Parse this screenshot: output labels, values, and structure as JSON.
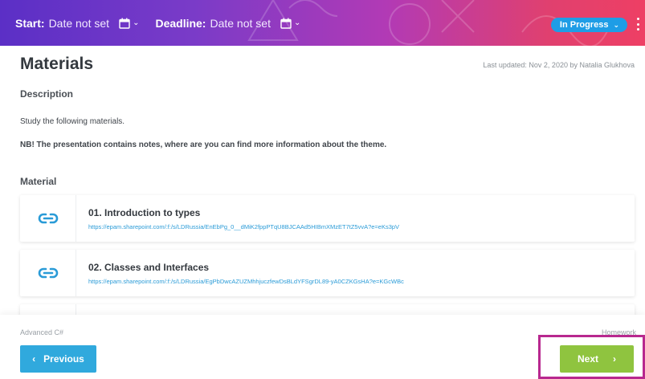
{
  "header": {
    "start_label": "Start:",
    "start_value": "Date not set",
    "deadline_label": "Deadline:",
    "deadline_value": "Date not set",
    "status": "In Progress",
    "calendar_icon": "calendar-icon",
    "chevron_icon": "chevron-down-icon",
    "kebab_icon": "kebab-menu-icon"
  },
  "page": {
    "title": "Materials",
    "updated": "Last updated: Nov 2, 2020 by Natalia Glukhova"
  },
  "description": {
    "heading": "Description",
    "line1": "Study the following materials.",
    "line2": "NB! The presentation contains notes, where are you can find more information about the theme."
  },
  "material": {
    "heading": "Material",
    "items": [
      {
        "title": "01. Introduction to types",
        "url": "https://epam.sharepoint.com/:f:/s/LDRussia/EnEbPg_0__dMiK2fppPTqU8BJCAAd5HIBmXMzET7tZ5vvA?e=eKs3pV",
        "icon": "link-icon"
      },
      {
        "title": "02. Classes and Interfaces",
        "url": "https://epam.sharepoint.com/:f:/s/LDRussia/EgPbDwcAZUZMhhjuczfewDsBLdYFSgrDL89-yA0CZKGsHA?e=KGcWBc",
        "icon": "link-icon"
      }
    ]
  },
  "footer": {
    "left_label": "Advanced C#",
    "right_label": "Homework",
    "prev_label": "Previous",
    "next_label": "Next"
  },
  "colors": {
    "header_start": "#5b2fc6",
    "header_end": "#ee3f64",
    "status_pill": "#1e9de6",
    "link": "#2a9bd7",
    "prev_button": "#30a9dd",
    "next_button": "#8fc43f",
    "highlight": "#b8288f"
  }
}
